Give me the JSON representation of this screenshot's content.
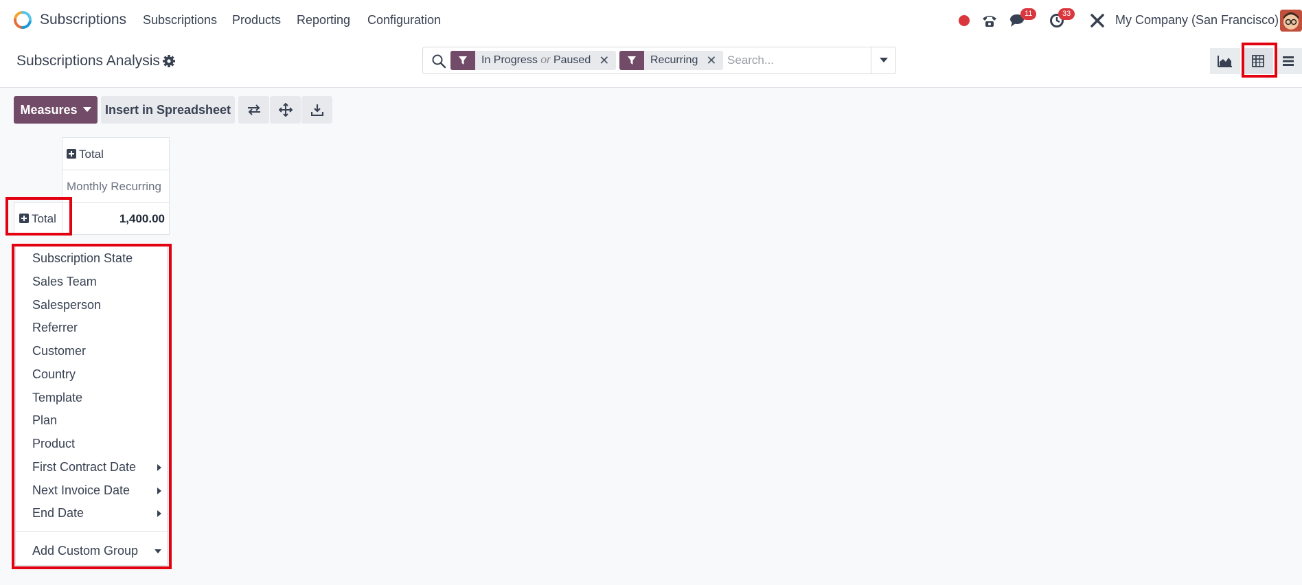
{
  "topbar": {
    "app_name": "Subscriptions",
    "menu": [
      "Subscriptions",
      "Products",
      "Reporting",
      "Configuration"
    ],
    "messages_count": "11",
    "activities_count": "33",
    "company": "My Company (San Francisco)"
  },
  "control_panel": {
    "title": "Subscriptions Analysis",
    "facets": [
      {
        "label": "In Progress",
        "connector": "or",
        "label2": "Paused"
      },
      {
        "label": "Recurring"
      }
    ],
    "search_placeholder": "Search..."
  },
  "toolbar": {
    "measures_label": "Measures",
    "insert_label": "Insert in Spreadsheet"
  },
  "pivot": {
    "col_header": "Total",
    "measure_header": "Monthly Recurring",
    "row_header": "Total",
    "total_value": "1,400.00"
  },
  "group_menu": {
    "items": [
      "Subscription State",
      "Sales Team",
      "Salesperson",
      "Referrer",
      "Customer",
      "Country",
      "Template",
      "Plan",
      "Product",
      "First Contract Date",
      "Next Invoice Date",
      "End Date"
    ],
    "custom_group_label": "Add Custom Group"
  },
  "colors": {
    "brand": "#714b67",
    "badge": "#d9363e",
    "highlight": "#e3000f"
  }
}
